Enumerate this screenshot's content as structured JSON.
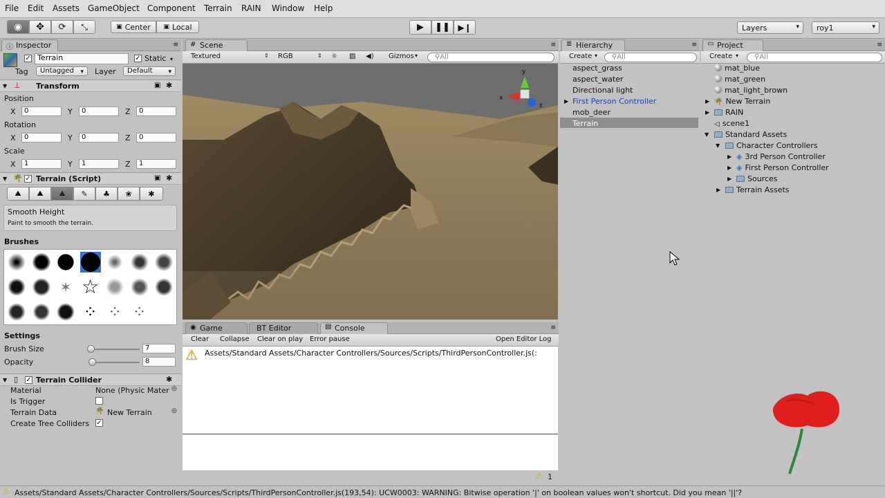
{
  "menu": [
    "File",
    "Edit",
    "Assets",
    "GameObject",
    "Component",
    "Terrain",
    "RAIN",
    "Window",
    "Help"
  ],
  "toolbar": {
    "pivot": "Center",
    "space": "Local",
    "layers": "Layers",
    "layout": "roy1"
  },
  "inspector": {
    "tab": "Inspector",
    "object_name": "Terrain",
    "static": "Static",
    "tag_label": "Tag",
    "tag_value": "Untagged",
    "layer_label": "Layer",
    "layer_value": "Default",
    "transform": {
      "title": "Transform",
      "position": "Position",
      "rotation": "Rotation",
      "scale": "Scale",
      "x": "X",
      "y": "Y",
      "z": "Z",
      "pos": [
        "0",
        "0",
        "0"
      ],
      "rot": [
        "0",
        "0",
        "0"
      ],
      "scl": [
        "1",
        "1",
        "1"
      ]
    },
    "terrain_script": {
      "title": "Terrain (Script)",
      "tool_name": "Smooth Height",
      "tool_desc": "Paint to smooth the terrain.",
      "brushes_label": "Brushes",
      "settings_label": "Settings",
      "brush_size_label": "Brush Size",
      "brush_size": "7",
      "opacity_label": "Opacity",
      "opacity": "8"
    },
    "collider": {
      "title": "Terrain Collider",
      "material_label": "Material",
      "material_value": "None (Physic Mater",
      "trigger_label": "Is Trigger",
      "data_label": "Terrain Data",
      "data_value": "New Terrain",
      "tree_label": "Create Tree Colliders"
    }
  },
  "scene": {
    "tab": "Scene",
    "render_mode": "Textured",
    "color_mode": "RGB",
    "gizmos": "Gizmos",
    "search": "All",
    "axis_y": "y",
    "axis_z": "z",
    "axis_x": "x"
  },
  "console": {
    "tabs": [
      "Game",
      "BT Editor",
      "Console"
    ],
    "buttons": [
      "Clear",
      "Collapse",
      "Clear on play",
      "Error pause"
    ],
    "open_log": "Open Editor Log",
    "message": "Assets/Standard Assets/Character Controllers/Sources/Scripts/ThirdPersonController.js(:",
    "warn_count": "1"
  },
  "hierarchy": {
    "tab": "Hierarchy",
    "create": "Create",
    "search": "All",
    "items": [
      "aspect_grass",
      "aspect_water",
      "Directional light",
      "First Person Controller",
      "mob_deer",
      "Terrain"
    ]
  },
  "project": {
    "tab": "Project",
    "create": "Create",
    "search": "All",
    "items": [
      "mat_blue",
      "mat_green",
      "mat_light_brown",
      "New Terrain",
      "RAIN",
      "scene1",
      "Standard Assets",
      "Character Controllers",
      "3rd Person Controller",
      "First Person Controller",
      "Sources",
      "Terrain Assets"
    ]
  },
  "statusbar": {
    "text": "Assets/Standard Assets/Character Controllers/Sources/Scripts/ThirdPersonController.js(193,54): UCW0003: WARNING: Bitwise operation '|' on boolean values won't shortcut. Did you mean '||'?"
  },
  "colors": {
    "selection": "#8e8e8e",
    "link_blue": "#1f3fb0",
    "warning": "#f2c200"
  }
}
